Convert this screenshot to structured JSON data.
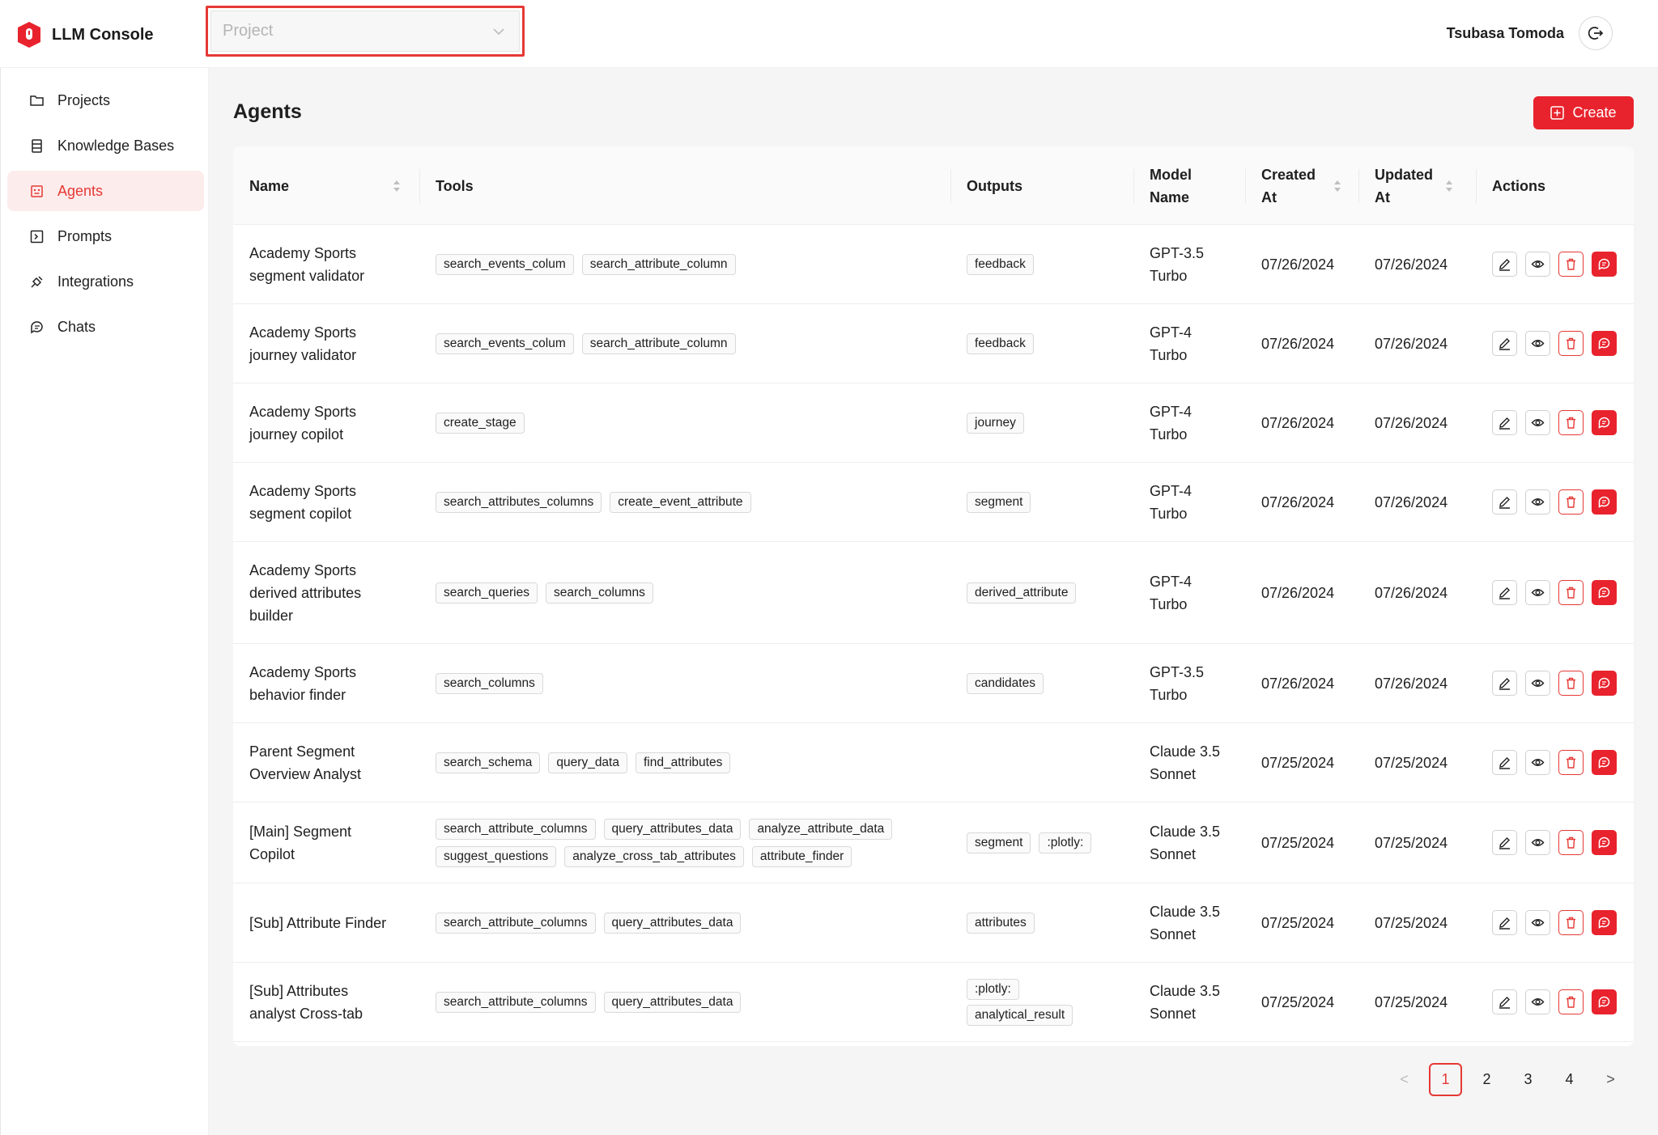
{
  "app": {
    "name": "LLM Console",
    "accent": "#e8232d"
  },
  "project_select": {
    "placeholder": "Project"
  },
  "user": {
    "name": "Tsubasa Tomoda"
  },
  "sidebar": {
    "items": [
      {
        "label": "Projects",
        "icon": "folder-icon"
      },
      {
        "label": "Knowledge Bases",
        "icon": "database-icon"
      },
      {
        "label": "Agents",
        "icon": "robot-icon",
        "active": true
      },
      {
        "label": "Prompts",
        "icon": "terminal-icon"
      },
      {
        "label": "Integrations",
        "icon": "plug-icon"
      },
      {
        "label": "Chats",
        "icon": "chat-icon"
      }
    ]
  },
  "page": {
    "title": "Agents",
    "create_label": "Create"
  },
  "table": {
    "headers": {
      "name": "Name",
      "tools": "Tools",
      "outputs": "Outputs",
      "model": "Model\nName",
      "created": "Created\nAt",
      "updated": "Updated\nAt",
      "actions": "Actions"
    },
    "rows": [
      {
        "name": "Academy Sports\nsegment validator",
        "tools": [
          "search_events_colum",
          "search_attribute_column"
        ],
        "outputs": [
          "feedback"
        ],
        "model": "GPT-3.5\nTurbo",
        "created": "07/26/2024",
        "updated": "07/26/2024"
      },
      {
        "name": "Academy Sports\njourney validator",
        "tools": [
          "search_events_colum",
          "search_attribute_column"
        ],
        "outputs": [
          "feedback"
        ],
        "model": "GPT-4\nTurbo",
        "created": "07/26/2024",
        "updated": "07/26/2024"
      },
      {
        "name": "Academy Sports\njourney copilot",
        "tools": [
          "create_stage"
        ],
        "outputs": [
          "journey"
        ],
        "model": "GPT-4\nTurbo",
        "created": "07/26/2024",
        "updated": "07/26/2024"
      },
      {
        "name": "Academy Sports\nsegment copilot",
        "tools": [
          "search_attributes_columns",
          "create_event_attribute"
        ],
        "outputs": [
          "segment"
        ],
        "model": "GPT-4\nTurbo",
        "created": "07/26/2024",
        "updated": "07/26/2024"
      },
      {
        "name": "Academy Sports\nderived attributes\nbuilder",
        "tools": [
          "search_queries",
          "search_columns"
        ],
        "outputs": [
          "derived_attribute"
        ],
        "model": "GPT-4\nTurbo",
        "created": "07/26/2024",
        "updated": "07/26/2024"
      },
      {
        "name": "Academy Sports\nbehavior finder",
        "tools": [
          "search_columns"
        ],
        "outputs": [
          "candidates"
        ],
        "model": "GPT-3.5\nTurbo",
        "created": "07/26/2024",
        "updated": "07/26/2024"
      },
      {
        "name": "Parent Segment\nOverview Analyst",
        "tools": [
          "search_schema",
          "query_data",
          "find_attributes"
        ],
        "outputs": [],
        "model": "Claude 3.5\nSonnet",
        "created": "07/25/2024",
        "updated": "07/25/2024"
      },
      {
        "name": "[Main] Segment\nCopilot",
        "tools": [
          "search_attribute_columns",
          "query_attributes_data",
          "analyze_attribute_data",
          "suggest_questions",
          "analyze_cross_tab_attributes",
          "attribute_finder"
        ],
        "outputs": [
          "segment",
          ":plotly:"
        ],
        "model": "Claude 3.5\nSonnet",
        "created": "07/25/2024",
        "updated": "07/25/2024"
      },
      {
        "name": "[Sub] Attribute Finder",
        "tools": [
          "search_attribute_columns",
          "query_attributes_data"
        ],
        "outputs": [
          "attributes"
        ],
        "model": "Claude 3.5\nSonnet",
        "created": "07/25/2024",
        "updated": "07/25/2024"
      },
      {
        "name": "[Sub] Attributes\nanalyst Cross-tab",
        "tools": [
          "search_attribute_columns",
          "query_attributes_data"
        ],
        "outputs": [
          ":plotly:",
          "analytical_result"
        ],
        "model": "Claude 3.5\nSonnet",
        "created": "07/25/2024",
        "updated": "07/25/2024"
      }
    ]
  },
  "pagination": {
    "pages": [
      "1",
      "2",
      "3",
      "4"
    ],
    "current": "1",
    "prev": "<",
    "next": ">"
  }
}
